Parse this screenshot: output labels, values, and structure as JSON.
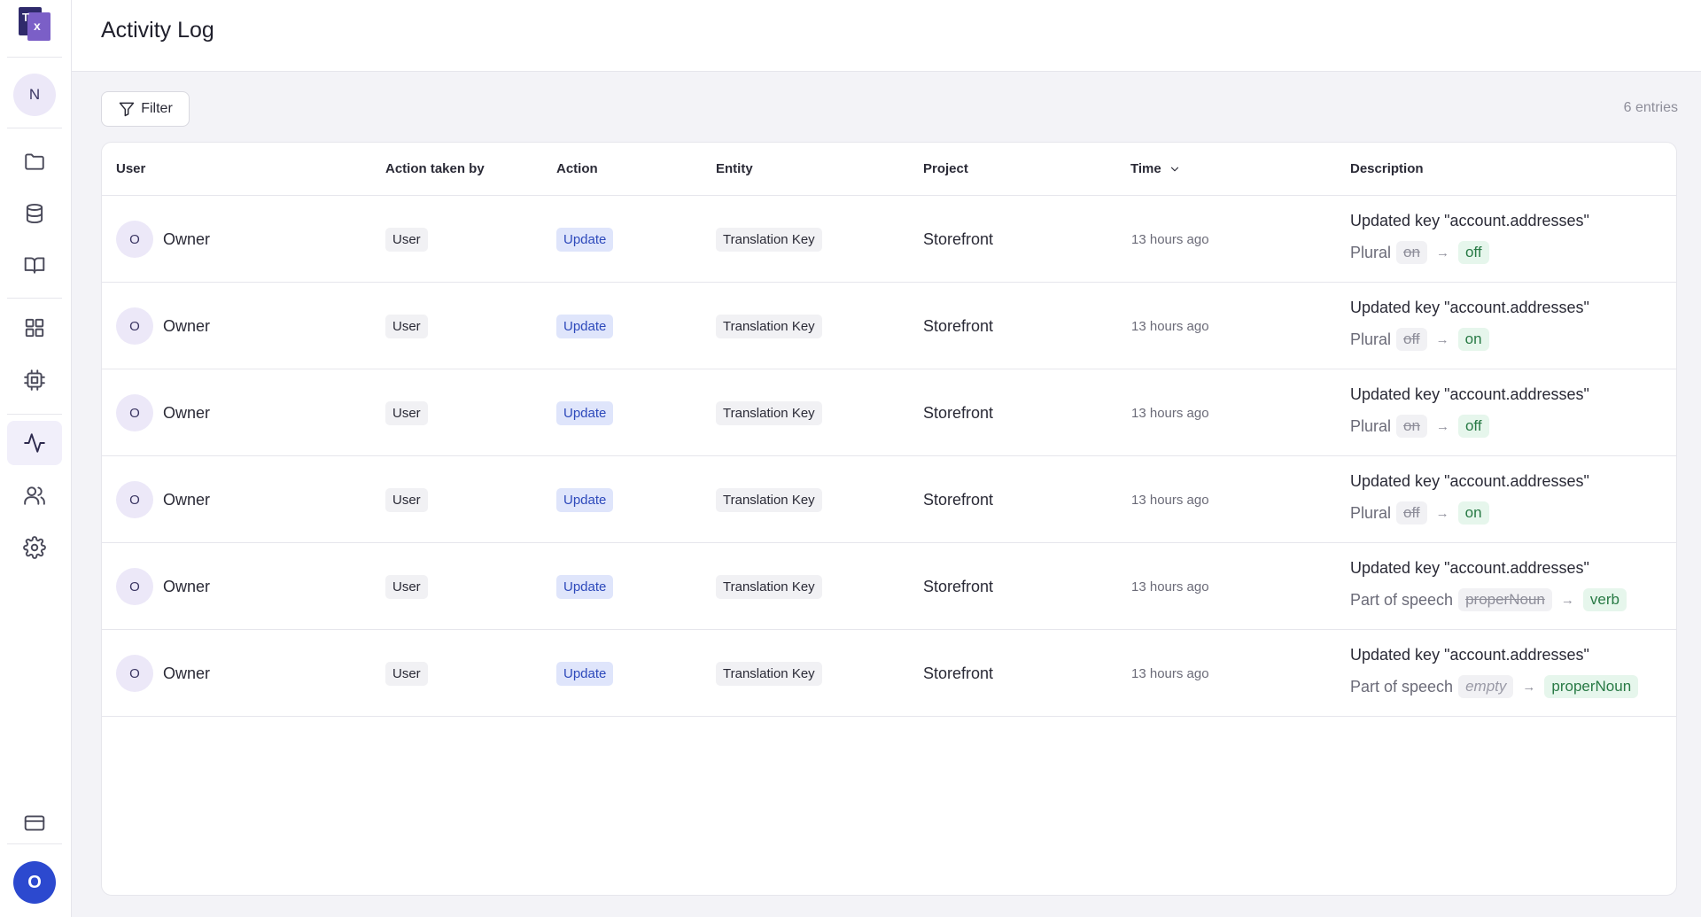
{
  "app": {
    "logo_letters": "TX"
  },
  "sidebar": {
    "workspace_initial": "N",
    "nav": [
      {
        "icon": "folder-icon"
      },
      {
        "icon": "database-icon"
      },
      {
        "icon": "book-icon"
      },
      {
        "icon": "grid-icon"
      },
      {
        "icon": "chip-icon"
      },
      {
        "icon": "activity-icon",
        "active": true
      },
      {
        "icon": "users-icon"
      },
      {
        "icon": "gear-icon"
      }
    ],
    "billing_icon": "credit-card-icon",
    "user_initial": "O"
  },
  "header": {
    "title": "Activity Log"
  },
  "toolbar": {
    "filter_label": "Filter",
    "entries": "6 entries"
  },
  "table": {
    "columns": {
      "user": "User",
      "action_taken_by": "Action taken by",
      "action": "Action",
      "entity": "Entity",
      "project": "Project",
      "time": "Time",
      "description": "Description"
    },
    "rows": [
      {
        "initial": "O",
        "user": "Owner",
        "taken_by": "User",
        "action": "Update",
        "entity": "Translation Key",
        "project": "Storefront",
        "time": "13 hours ago",
        "desc_title": "Updated key \"account.addresses\"",
        "change_label": "Plural",
        "old": "on",
        "new": "off"
      },
      {
        "initial": "O",
        "user": "Owner",
        "taken_by": "User",
        "action": "Update",
        "entity": "Translation Key",
        "project": "Storefront",
        "time": "13 hours ago",
        "desc_title": "Updated key \"account.addresses\"",
        "change_label": "Plural",
        "old": "off",
        "new": "on"
      },
      {
        "initial": "O",
        "user": "Owner",
        "taken_by": "User",
        "action": "Update",
        "entity": "Translation Key",
        "project": "Storefront",
        "time": "13 hours ago",
        "desc_title": "Updated key \"account.addresses\"",
        "change_label": "Plural",
        "old": "on",
        "new": "off"
      },
      {
        "initial": "O",
        "user": "Owner",
        "taken_by": "User",
        "action": "Update",
        "entity": "Translation Key",
        "project": "Storefront",
        "time": "13 hours ago",
        "desc_title": "Updated key \"account.addresses\"",
        "change_label": "Plural",
        "old": "off",
        "new": "on"
      },
      {
        "initial": "O",
        "user": "Owner",
        "taken_by": "User",
        "action": "Update",
        "entity": "Translation Key",
        "project": "Storefront",
        "time": "13 hours ago",
        "desc_title": "Updated key \"account.addresses\"",
        "change_label": "Part of speech",
        "old": "properNoun",
        "new": "verb"
      },
      {
        "initial": "O",
        "user": "Owner",
        "taken_by": "User",
        "action": "Update",
        "entity": "Translation Key",
        "project": "Storefront",
        "time": "13 hours ago",
        "desc_title": "Updated key \"account.addresses\"",
        "change_label": "Part of speech",
        "old": "empty",
        "old_is_empty": true,
        "new": "properNoun"
      }
    ]
  }
}
